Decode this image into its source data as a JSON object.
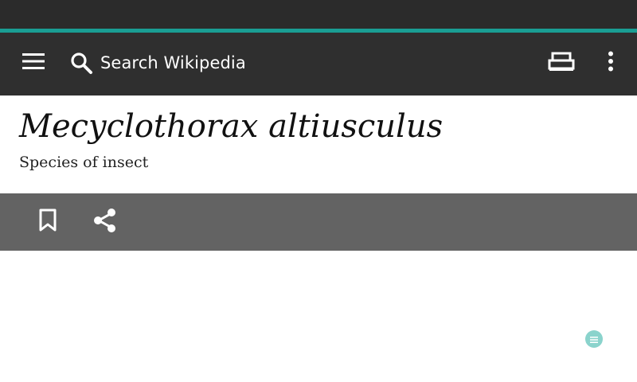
{
  "toolbar": {
    "search_placeholder": "Search Wikipedia",
    "menu_icon": "hamburger-menu-icon",
    "search_icon": "search-icon",
    "reading_icon": "reading-list-icon",
    "overflow_icon": "more-vertical-icon"
  },
  "article": {
    "title": "Mecyclothorax altiusculus",
    "description": "Species of insect"
  },
  "actions": {
    "bookmark_icon": "bookmark-icon",
    "share_icon": "share-icon"
  },
  "fab": {
    "icon": "table-of-contents-icon"
  },
  "colors": {
    "status_bar": "#2b2b2b",
    "accent": "#1a9e94",
    "toolbar": "#2f2f2f",
    "action_bar": "#636363",
    "fab": "#8ad3cc"
  }
}
